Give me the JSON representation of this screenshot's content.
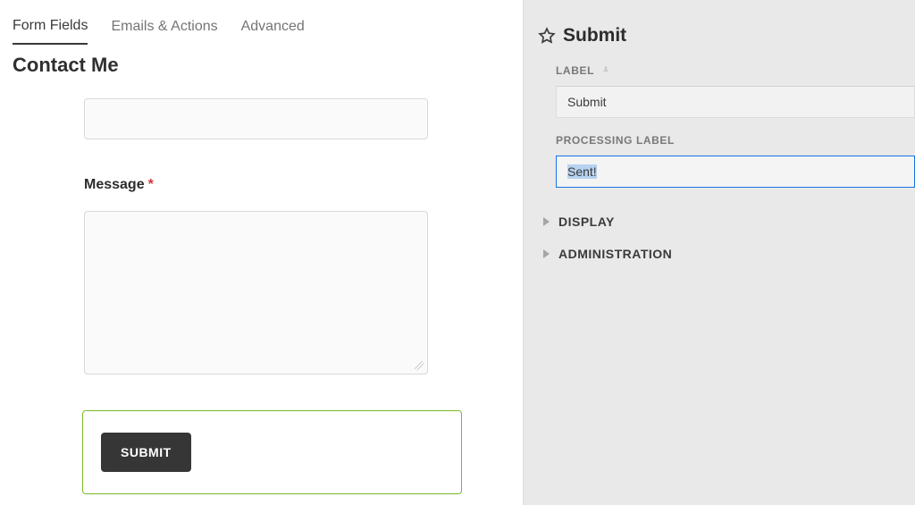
{
  "tabs": {
    "form_fields": "Form Fields",
    "emails_actions": "Emails & Actions",
    "advanced": "Advanced"
  },
  "form": {
    "title": "Contact Me",
    "message_label": "Message",
    "required_mark": "*",
    "submit_label": "SUBMIT"
  },
  "sidebar": {
    "title": "Submit",
    "label_heading": "LABEL",
    "label_value": "Submit",
    "processing_heading": "PROCESSING LABEL",
    "processing_value": "Sent!",
    "display": "DISPLAY",
    "administration": "ADMINISTRATION"
  }
}
